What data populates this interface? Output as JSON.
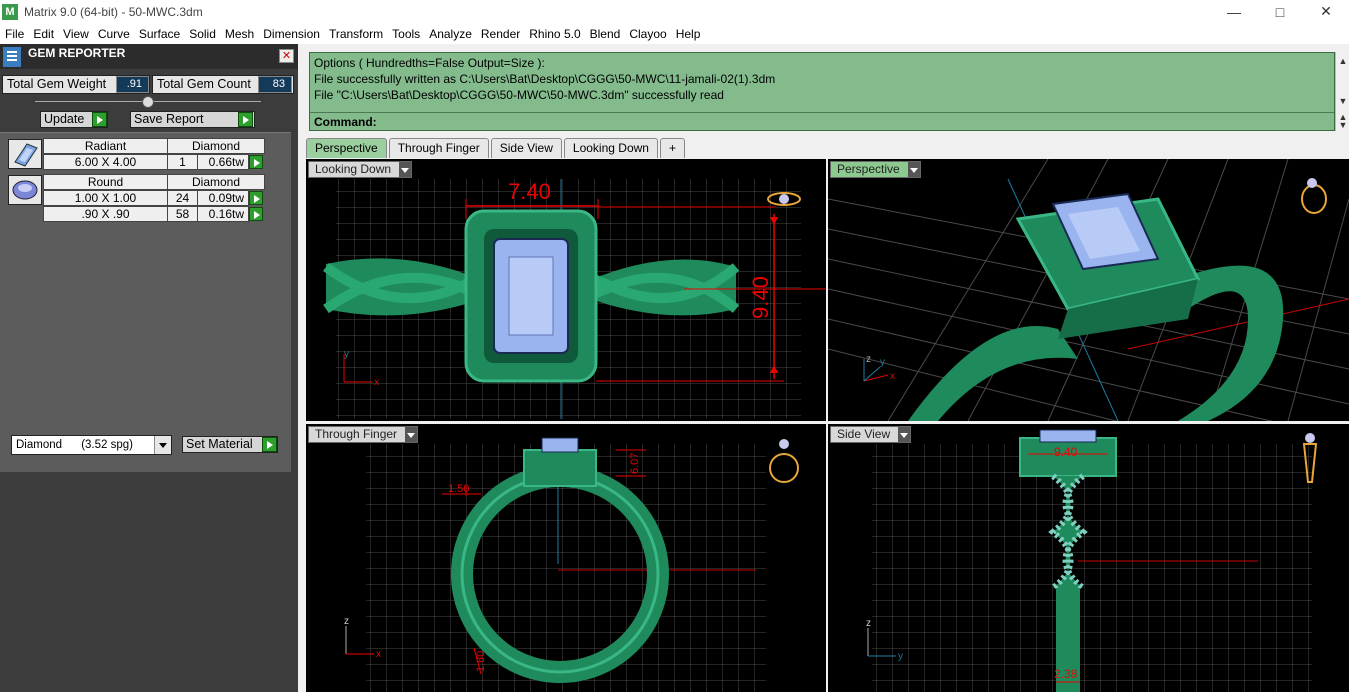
{
  "window": {
    "title": "Matrix 9.0 (64-bit) - 50-MWC.3dm",
    "controls": [
      "minimize",
      "maximize",
      "close"
    ]
  },
  "menu": [
    "File",
    "Edit",
    "View",
    "Curve",
    "Surface",
    "Solid",
    "Mesh",
    "Dimension",
    "Transform",
    "Tools",
    "Analyze",
    "Render",
    "Rhino 5.0",
    "Blend",
    "Clayoo",
    "Help"
  ],
  "gem_reporter": {
    "title": "GEM REPORTER",
    "total_weight_label": "Total Gem Weight",
    "total_weight_value": ".91",
    "total_count_label": "Total Gem Count",
    "total_count_value": "83",
    "update_label": "Update",
    "save_label": "Save Report",
    "gems": [
      {
        "shape": "Radiant",
        "material": "Diamond",
        "rows": [
          {
            "size": "6.00 X 4.00",
            "count": "1",
            "weight": "0.66tw"
          }
        ]
      },
      {
        "shape": "Round",
        "material": "Diamond",
        "rows": [
          {
            "size": "1.00 X 1.00",
            "count": "24",
            "weight": "0.09tw"
          },
          {
            "size": ".90 X .90",
            "count": "58",
            "weight": "0.16tw"
          }
        ]
      }
    ],
    "material_select": "Diamond      (3.52 spg)",
    "set_material_label": "Set Material"
  },
  "command": {
    "lines": [
      "Options ( Hundredths=False  Output=Size ):",
      "File successfully written as C:\\Users\\Bat\\Desktop\\CGGG\\50-MWC\\11-jamali-02(1).3dm",
      "File \"C:\\Users\\Bat\\Desktop\\CGGG\\50-MWC\\50-MWC.3dm\" successfully read"
    ],
    "prompt": "Command:"
  },
  "tabs": [
    "Perspective",
    "Through Finger",
    "Side View",
    "Looking Down",
    "+"
  ],
  "active_tab": "Perspective",
  "viewports": {
    "looking_down": {
      "label": "Looking Down",
      "dim_width": "7.40",
      "dim_height": "9.40",
      "axis_x": "x",
      "axis_y": "y"
    },
    "perspective": {
      "label": "Perspective",
      "axis_x": "x",
      "axis_y": "y",
      "axis_z": "z"
    },
    "through_finger": {
      "label": "Through Finger",
      "dim_a": "1.50",
      "dim_b": "6.07",
      "dim_c": "1.80",
      "axis_x": "x",
      "axis_z": "z"
    },
    "side_view": {
      "label": "Side View",
      "dim_top": "9.40",
      "dim_bottom": "2.38",
      "axis_y": "y",
      "axis_z": "z"
    }
  },
  "colors": {
    "model_green": "#1f8a5c",
    "gem_blue": "#9ab4f0",
    "dimension_red": "#e00000",
    "command_bg": "#83bb8d",
    "active_tab": "#9bcf9f"
  }
}
